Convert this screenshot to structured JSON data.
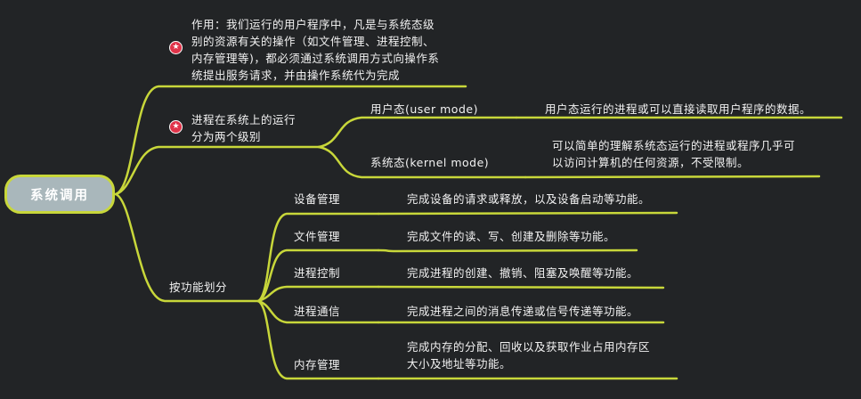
{
  "root": {
    "label": "系统调用"
  },
  "purpose": {
    "icon": "star-icon",
    "lines": [
      "作用：我们运行的用户程序中，凡是与系统态级",
      "别的资源有关的操作（如文件管理、进程控制、",
      "内存管理等)，都必须通过系统调用方式向操作系",
      "统提出服务请求，并由操作系统代为完成"
    ]
  },
  "levels": {
    "icon": "star-icon",
    "lines": [
      "进程在系统上的运行",
      "分为两个级别"
    ],
    "modes": [
      {
        "name": "用户态(user mode)",
        "desc": [
          "用户态运行的进程或可以直接读取用户程序的数据。"
        ]
      },
      {
        "name": "系统态(kernel mode)",
        "desc": [
          "可以简单的理解系统态运行的进程或程序几乎可",
          "以访问计算机的任何资源，不受限制。"
        ]
      }
    ]
  },
  "functions": {
    "label": "按功能划分",
    "items": [
      {
        "name": "设备管理",
        "desc": [
          "完成设备的请求或释放，以及设备启动等功能。"
        ]
      },
      {
        "name": "文件管理",
        "desc": [
          "完成文件的读、写、创建及删除等功能。"
        ]
      },
      {
        "name": "进程控制",
        "desc": [
          "完成进程的创建、撤销、阻塞及唤醒等功能。"
        ]
      },
      {
        "name": "进程通信",
        "desc": [
          "完成进程之间的消息传递或信号传递等功能。"
        ]
      },
      {
        "name": "内存管理",
        "desc": [
          "完成内存的分配、回收以及获取作业占用内存区",
          "大小及地址等功能。"
        ]
      }
    ]
  },
  "colors": {
    "background": "#222426",
    "line": "#c8d73a",
    "root_fill": "#a9b7bb",
    "star": "#e0344a",
    "text": "#f2f2f2"
  }
}
